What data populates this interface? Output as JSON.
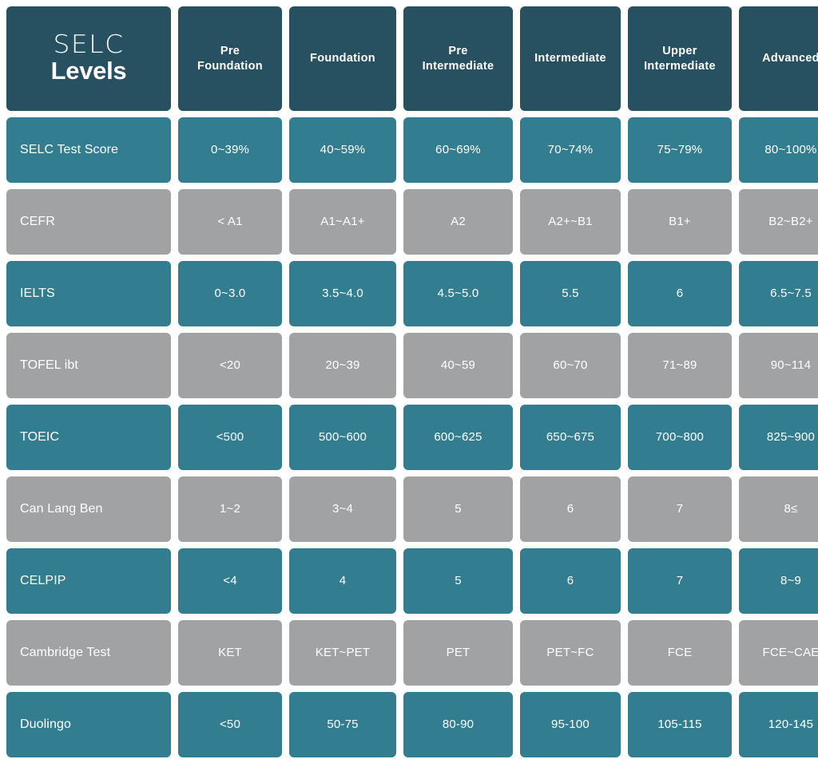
{
  "logo": {
    "line1": "SELC",
    "line2": "Levels"
  },
  "colors": {
    "header": "#275160",
    "teal": "#337d91",
    "gray": "#a0a2a4",
    "text": "#ffffff",
    "background": "#ffffff"
  },
  "chart_data": {
    "type": "table",
    "title": "SELC Levels",
    "columns": [
      "SELC Levels",
      "Pre Foundation",
      "Foundation",
      "Pre Intermediate",
      "Intermediate",
      "Upper Intermediate",
      "Advanced"
    ],
    "column_lines": [
      [
        "SELC",
        "Levels"
      ],
      [
        "Pre",
        "Foundation"
      ],
      [
        "Foundation"
      ],
      [
        "Pre",
        "Intermediate"
      ],
      [
        "Intermediate"
      ],
      [
        "Upper",
        "Intermediate"
      ],
      [
        "Advanced"
      ]
    ],
    "rows": [
      {
        "label": "SELC Test Score",
        "style": "teal",
        "values": [
          "0~39%",
          "40~59%",
          "60~69%",
          "70~74%",
          "75~79%",
          "80~100%"
        ]
      },
      {
        "label": "CEFR",
        "style": "gray",
        "values": [
          "< A1",
          "A1~A1+",
          "A2",
          "A2+~B1",
          "B1+",
          "B2~B2+"
        ]
      },
      {
        "label": "IELTS",
        "style": "teal",
        "values": [
          "0~3.0",
          "3.5~4.0",
          "4.5~5.0",
          "5.5",
          "6",
          "6.5~7.5"
        ]
      },
      {
        "label": "TOFEL ibt",
        "style": "gray",
        "values": [
          "<20",
          "20~39",
          "40~59",
          "60~70",
          "71~89",
          "90~114"
        ]
      },
      {
        "label": "TOEIC",
        "style": "teal",
        "values": [
          "<500",
          "500~600",
          "600~625",
          "650~675",
          "700~800",
          "825~900"
        ]
      },
      {
        "label": "Can Lang Ben",
        "style": "gray",
        "values": [
          "1~2",
          "3~4",
          "5",
          "6",
          "7",
          "8≤"
        ]
      },
      {
        "label": "CELPIP",
        "style": "teal",
        "values": [
          "<4",
          "4",
          "5",
          "6",
          "7",
          "8~9"
        ]
      },
      {
        "label": "Cambridge Test",
        "style": "gray",
        "values": [
          "KET",
          "KET~PET",
          "PET",
          "PET~FC",
          "FCE",
          "FCE~CAE"
        ]
      },
      {
        "label": "Duolingo",
        "style": "teal",
        "values": [
          "<50",
          "50-75",
          "80-90",
          "95-100",
          "105-115",
          "120-145"
        ]
      }
    ]
  }
}
